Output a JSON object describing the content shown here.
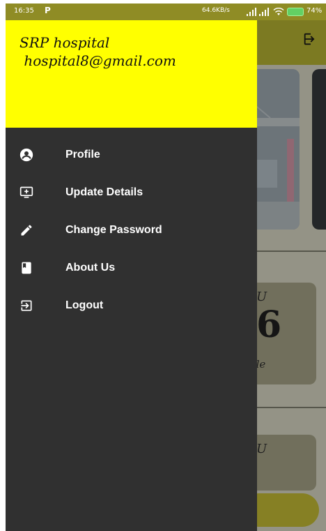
{
  "status_bar": {
    "time": "16:35",
    "network_speed": "64.6KB/s",
    "battery_percent": "74%",
    "colors": {
      "background": "#8f8c25",
      "battery": "#63d063"
    }
  },
  "drawer": {
    "header": {
      "name": "SRP hospital",
      "email": " hospital8@gmail.com",
      "background": "#ffff00"
    },
    "items": [
      {
        "label": "Profile",
        "icon": "account-circle-icon"
      },
      {
        "label": "Update Details",
        "icon": "monitor-add-icon"
      },
      {
        "label": "Change Password",
        "icon": "pencil-icon"
      },
      {
        "label": "About Us",
        "icon": "book-icon"
      },
      {
        "label": "Logout",
        "icon": "logout-icon"
      }
    ],
    "background": "#303030"
  },
  "background_app": {
    "cards": [
      {
        "letter": "U",
        "value": "6",
        "caption": "ble"
      },
      {
        "letter": "U",
        "value": ""
      }
    ],
    "accent": "#c9c637"
  }
}
